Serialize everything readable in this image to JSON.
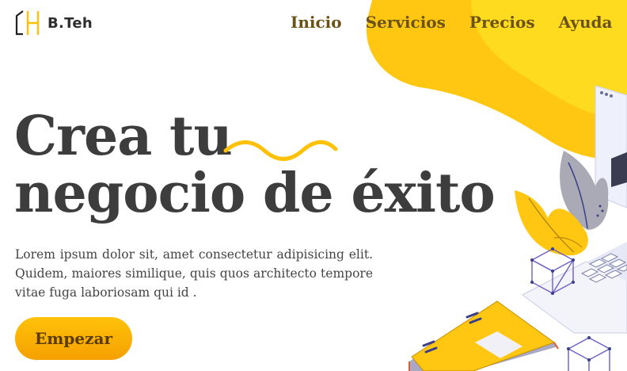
{
  "brand": {
    "name": "B.Teh",
    "icon": "bracket-h-logo-icon",
    "accent": "#ffc107"
  },
  "nav": {
    "items": [
      "Inicio",
      "Servicios",
      "Precios",
      "Ayuda"
    ]
  },
  "hero": {
    "title_line1": "Crea tu",
    "title_line2": "negocio de éxito",
    "description": "Lorem ipsum dolor sit, amet consectetur adipisicing elit. Quidem, maiores similique, quis quos architecto tempore vitae fuga laboriosam qui id .",
    "cta_label": "Empezar"
  },
  "colors": {
    "yellow": "#ffc93c",
    "yellow_light": "#ffde33",
    "text": "#3d3d3d",
    "button": "#ffb300"
  }
}
